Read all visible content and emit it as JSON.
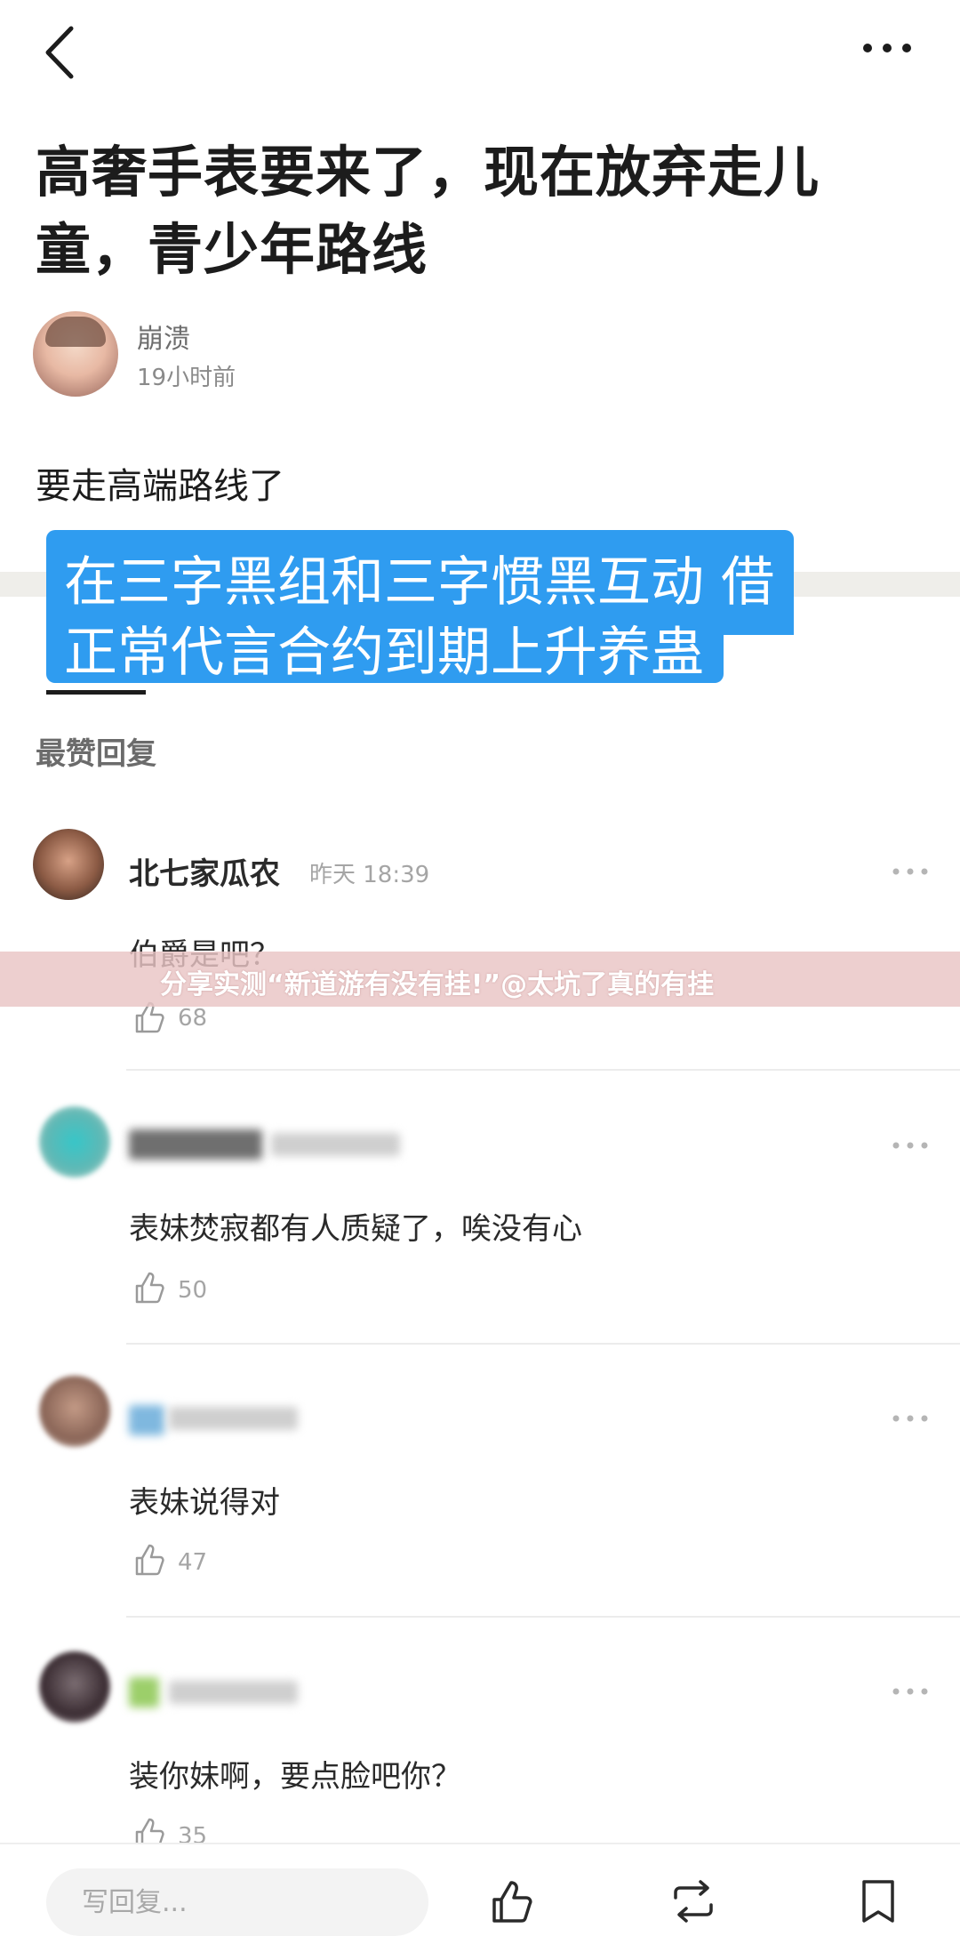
{
  "post": {
    "title_line1": "高奢手表要来了，现在放弃走儿",
    "title_line2": "童，青少年路线",
    "author": {
      "name": "崩溃",
      "time": "19小时前"
    },
    "body": "要走高端路线了",
    "overlay_caption_line1": "在三字黑组和三字惯黑互动 借",
    "overlay_caption_line2": "正常代言合约到期上升养蛊"
  },
  "comments_section": {
    "header": "最赞回复",
    "comments": [
      {
        "name": "北七家瓜农",
        "date": "昨天 18:39",
        "text": "伯爵是吧？",
        "likes": "68"
      },
      {
        "name": "",
        "date": "",
        "text": "表妹焚寂都有人质疑了，唉没有心",
        "likes": "50"
      },
      {
        "name": "",
        "date": "",
        "text": "表妹说得对",
        "likes": "47"
      },
      {
        "name": "",
        "date": "",
        "text": "装你妹啊，要点脸吧你？",
        "likes": "35"
      }
    ]
  },
  "banner": {
    "text": "分享实测“新道游有没有挂!”@太坑了真的有挂"
  },
  "bottom_bar": {
    "reply_placeholder": "写回复..."
  },
  "colors": {
    "caption_bg": "#2f9cf0",
    "banner_bg": "#e9c4c4"
  },
  "icons": [
    "back-arrow-icon",
    "more-dots-icon",
    "thumbs-up-icon",
    "repost-icon",
    "bookmark-icon"
  ]
}
